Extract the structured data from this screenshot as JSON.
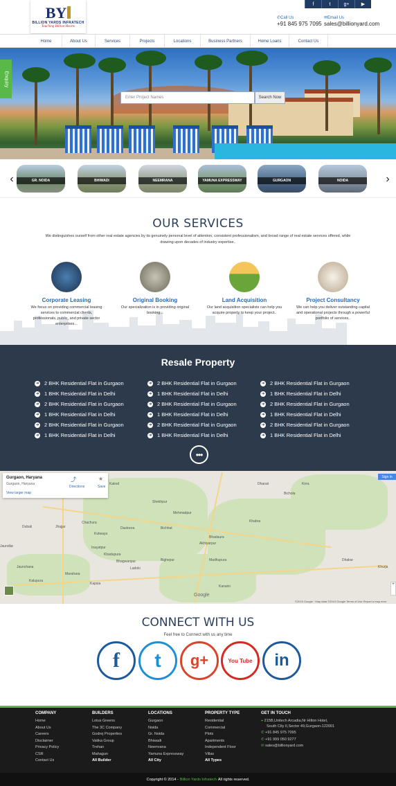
{
  "brand": {
    "mark": "BY",
    "name": "BILLION YARDS INFRATECH",
    "tagline": "Touching Billion Hearts"
  },
  "top_social": [
    "f-icon",
    "twitter-icon",
    "google-plus-icon",
    "youtube-icon"
  ],
  "header": {
    "call_label": "Call Us",
    "call_value": "+91 845 975 7095",
    "email_label": "Email Us",
    "email_value": "sales@billionyard.com"
  },
  "nav": [
    "Home",
    "About Us",
    "Services",
    "Projects",
    "Locations",
    "Business Partners",
    "Home Loans",
    "Contact Us"
  ],
  "enquiry": "Enquiry",
  "search": {
    "placeholder": "Enter Project Names",
    "button": "Search Now"
  },
  "locations": [
    "GR. NOIDA",
    "BHIWADI",
    "NEEMRANA",
    "YAMUNA EXPRESSWAY",
    "GURGAON",
    "NOIDA"
  ],
  "services": {
    "title": "OUR SERVICES",
    "intro": "We distinguishes ourself from other real estate agencies by its genuinely personal level of attention, consistent professionalism, and broad range of real estate services offered, while drawing upon decades of industry expertise..",
    "items": [
      {
        "title": "Corporate Leasing",
        "desc": "We focus on providing commercial leasing services to commercial clients, professionals, public, and private sector enterprises..."
      },
      {
        "title": "Original Booking",
        "desc": "Our specialization is in providing original booking..."
      },
      {
        "title": "Land Acquisition",
        "desc": "Our land acquisition specialists can help you acquire property to keep your project.."
      },
      {
        "title": "Project Consultancy",
        "desc": "We can help you deliver outstanding capital and operational projects through a powerful portfolio of services.."
      }
    ]
  },
  "resale": {
    "title": "Resale Property",
    "columns": [
      [
        "2 BHK Residential Flat in Gurgaon",
        "1 BHK Residential Flat in Delhi",
        "2 BHK Residential Flat in Gurgaon",
        "1 BHK Residential Flat in Delhi",
        "2 BHK Residential Flat in Gurgaon",
        "1 BHK Residential Flat in Delhi"
      ],
      [
        "2 BHK Residential Flat in Gurgaon",
        "1 BHK Residential Flat in Delhi",
        "2 BHK Residential Flat in Gurgaon",
        "1 BHK Residential Flat in Delhi",
        "2 BHK Residential Flat in Gurgaon",
        "1 BHK Residential Flat in Delhi"
      ],
      [
        "2 BHK Residential Flat in Gurgaon",
        "1 BHK Residential Flat in Delhi",
        "2 BHK Residential Flat in Gurgaon",
        "1 BHK Residential Flat in Delhi",
        "2 BHK Residential Flat in Gurgaon",
        "1 BHK Residential Flat in Delhi"
      ]
    ]
  },
  "map": {
    "place": "Gurgaon, Haryana",
    "place_sub": "Gurgaon, Haryana",
    "larger_link": "View larger map",
    "directions": "Directions",
    "save": "Save",
    "signin": "Sign in",
    "labels": [
      "Kakod",
      "Dharari",
      "Kirra",
      "Bichola",
      "Shekhpur",
      "Mehmadpur",
      "Dastoora",
      "Bichhat",
      "Khabra",
      "Chachura",
      "Dubali",
      "Jhajjar",
      "Kutwaya",
      "Akhtyarpur",
      "Bhadaura",
      "Jaundlar",
      "Inayatpur",
      "Khadupura",
      "Bhagwanpur",
      "Ladoki",
      "Bighepur",
      "Madhupura",
      "Dhakar",
      "Khurja",
      "Jaunchana",
      "Marahara",
      "Kapsia",
      "Kalupura",
      "Kanaini"
    ],
    "google": "Google",
    "credits": "©2015 Google · Map data ©2015 Google    Terms of Use    Report a map error"
  },
  "connect": {
    "title": "CONNECT WITH US",
    "subtitle": "Feel free to Connect with us any time",
    "items": [
      {
        "label": "f",
        "color": "#1d5a9b",
        "icon": "facebook-icon"
      },
      {
        "label": "t",
        "color": "#1d8fd6",
        "icon": "twitter-icon"
      },
      {
        "label": "g+",
        "color": "#d9452b",
        "icon": "google-plus-icon"
      },
      {
        "label": "You Tube",
        "color": "#d52a22",
        "icon": "youtube-icon"
      },
      {
        "label": "in",
        "color": "#1d5a9b",
        "icon": "linkedin-icon"
      }
    ]
  },
  "footer": {
    "company": {
      "heading": "COMPANY",
      "items": [
        "Home",
        "About Us",
        "Careers",
        "Disclaimer",
        "Privacy Policy",
        "CSR",
        "Contact Us"
      ]
    },
    "builders": {
      "heading": "BUILDERS",
      "items": [
        "Lotus Greens",
        "The 3C Company",
        "Godrej Properties",
        "Vatika Group",
        "Trehan",
        "Mahagun"
      ],
      "all": "All Builder"
    },
    "locations": {
      "heading": "LOCATIONS",
      "items": [
        "Gurgaon",
        "Noida",
        "Gr. Noida",
        "Bhiwadi",
        "Neemrana",
        "Yamuna Expressway"
      ],
      "all": "All City"
    },
    "property_type": {
      "heading": "PROPERTY TYPE",
      "items": [
        "Residential",
        "Commercial",
        "Plots",
        "Apartments",
        "Independent Floor",
        "Villas"
      ],
      "all": "All Types"
    },
    "touch": {
      "heading": "GET IN TOUCH",
      "address": "215B,Unitech Arcadia,Nr Hilton Hotel,",
      "address2": "South City II,Sector 49,Gurgaon-122001",
      "phone1": "+91 845 975 7095",
      "phone2": "+91 999 050 9277",
      "email": "sales@billionyard.com"
    }
  },
  "copyright": {
    "prefix": "Copyright © 2014 -",
    "brand": "Billion Yards Infratech",
    "suffix": "All rights reserved."
  }
}
